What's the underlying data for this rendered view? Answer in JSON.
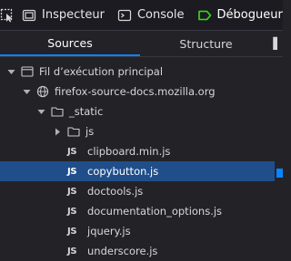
{
  "toolbar": {
    "tabs": [
      {
        "label": "Inspecteur",
        "icon": "inspector-icon"
      },
      {
        "label": "Console",
        "icon": "console-icon"
      },
      {
        "label": "Débogueur",
        "icon": "debugger-icon",
        "active": true
      }
    ]
  },
  "panel_tabs": {
    "sources": "Sources",
    "structure": "Structure"
  },
  "tree": {
    "thread": "Fil d’exécution principal",
    "domain": "firefox-source-docs.mozilla.org",
    "folder_static": "_static",
    "folder_js": "js",
    "badge": "JS",
    "files": [
      "clipboard.min.js",
      "copybutton.js",
      "doctools.js",
      "documentation_options.js",
      "jquery.js",
      "underscore.js"
    ],
    "selected_file": "copybutton.js"
  },
  "colors": {
    "accent": "#0a84ff",
    "selected_row": "#204e8a",
    "debugger_icon": "#30e60b"
  }
}
